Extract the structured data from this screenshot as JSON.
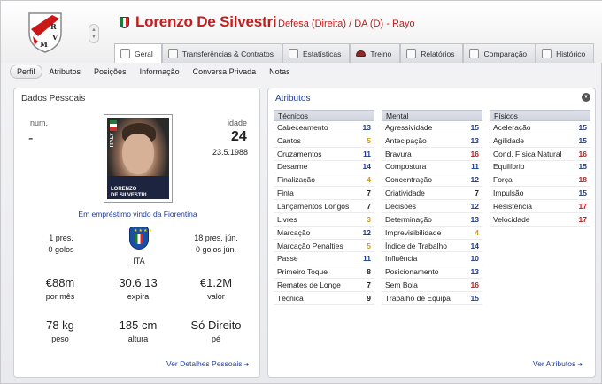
{
  "header": {
    "player_name": "Lorenzo De Silvestri",
    "role": "Defesa (Direita) / DA (D) - Rayo",
    "club_crest_letters": "RVM"
  },
  "tabs": [
    {
      "label": "Geral",
      "active": true,
      "icon": "profile-card-icon"
    },
    {
      "label": "Transferências & Contratos",
      "active": false,
      "icon": "document-icon"
    },
    {
      "label": "Estatísticas",
      "active": false,
      "icon": "stats-icon"
    },
    {
      "label": "Treino",
      "active": false,
      "icon": "cap-icon"
    },
    {
      "label": "Relatórios",
      "active": false,
      "icon": "report-icon"
    },
    {
      "label": "Comparação",
      "active": false,
      "icon": "compare-icon"
    },
    {
      "label": "Histórico",
      "active": false,
      "icon": "history-icon"
    }
  ],
  "subnav": [
    "Perfil",
    "Atributos",
    "Posições",
    "Informação",
    "Conversa Privada",
    "Notas"
  ],
  "personal": {
    "title": "Dados Pessoais",
    "num_label": "num.",
    "num_value": "-",
    "age_label": "idade",
    "age_value": "24",
    "dob": "23.5.1988",
    "photo_caption_1": "LORENZO",
    "photo_caption_2": "DE SILVESTRI",
    "photo_country": "ITALY",
    "loan_text": "Em empréstimo vindo da Fiorentina",
    "caps_left_1": "1 pres.",
    "caps_left_2": "0 golos",
    "nation": "ITA",
    "caps_right_1": "18 pres. jún.",
    "caps_right_2": "0 golos jún.",
    "wage_value": "€88m",
    "wage_label": "por mês",
    "expires_value": "30.6.13",
    "expires_label": "expira",
    "value_value": "€1.2M",
    "value_label": "valor",
    "weight_value": "78 kg",
    "weight_label": "peso",
    "height_value": "185 cm",
    "height_label": "altura",
    "foot_value": "Só Direito",
    "foot_label": "pé",
    "details_link": "Ver Detalhes Pessoais"
  },
  "attributes": {
    "title": "Atributos",
    "link": "Ver Atributos",
    "technical": {
      "title": "Técnicos",
      "rows": [
        {
          "name": "Cabeceamento",
          "value": "13",
          "color": "blue"
        },
        {
          "name": "Cantos",
          "value": "5",
          "color": "yellow"
        },
        {
          "name": "Cruzamentos",
          "value": "11",
          "color": "blue"
        },
        {
          "name": "Desarme",
          "value": "14",
          "color": "blue"
        },
        {
          "name": "Finalização",
          "value": "4",
          "color": "yellow"
        },
        {
          "name": "Finta",
          "value": "7",
          "color": "black"
        },
        {
          "name": "Lançamentos Longos",
          "value": "7",
          "color": "black"
        },
        {
          "name": "Livres",
          "value": "3",
          "color": "yellow"
        },
        {
          "name": "Marcação",
          "value": "12",
          "color": "blue"
        },
        {
          "name": "Marcação Penalties",
          "value": "5",
          "color": "yellow"
        },
        {
          "name": "Passe",
          "value": "11",
          "color": "blue"
        },
        {
          "name": "Primeiro Toque",
          "value": "8",
          "color": "black"
        },
        {
          "name": "Remates de Longe",
          "value": "7",
          "color": "black"
        },
        {
          "name": "Técnica",
          "value": "9",
          "color": "black"
        }
      ]
    },
    "mental": {
      "title": "Mental",
      "rows": [
        {
          "name": "Agressividade",
          "value": "15",
          "color": "blue"
        },
        {
          "name": "Antecipação",
          "value": "13",
          "color": "blue"
        },
        {
          "name": "Bravura",
          "value": "16",
          "color": "red"
        },
        {
          "name": "Compostura",
          "value": "11",
          "color": "blue"
        },
        {
          "name": "Concentração",
          "value": "12",
          "color": "blue"
        },
        {
          "name": "Criatividade",
          "value": "7",
          "color": "black"
        },
        {
          "name": "Decisões",
          "value": "12",
          "color": "blue"
        },
        {
          "name": "Determinação",
          "value": "13",
          "color": "blue"
        },
        {
          "name": "Imprevisibilidade",
          "value": "4",
          "color": "yellow"
        },
        {
          "name": "Índice de Trabalho",
          "value": "14",
          "color": "blue"
        },
        {
          "name": "Influência",
          "value": "10",
          "color": "blue"
        },
        {
          "name": "Posicionamento",
          "value": "13",
          "color": "blue"
        },
        {
          "name": "Sem Bola",
          "value": "16",
          "color": "red"
        },
        {
          "name": "Trabalho de Equipa",
          "value": "15",
          "color": "blue"
        }
      ]
    },
    "physical": {
      "title": "Físicos",
      "rows": [
        {
          "name": "Aceleração",
          "value": "15",
          "color": "blue"
        },
        {
          "name": "Agilidade",
          "value": "15",
          "color": "blue"
        },
        {
          "name": "Cond. Física Natural",
          "value": "16",
          "color": "red"
        },
        {
          "name": "Equilíbrio",
          "value": "15",
          "color": "blue"
        },
        {
          "name": "Força",
          "value": "18",
          "color": "red"
        },
        {
          "name": "Impulsão",
          "value": "15",
          "color": "blue"
        },
        {
          "name": "Resistência",
          "value": "17",
          "color": "red"
        },
        {
          "name": "Velocidade",
          "value": "17",
          "color": "red"
        }
      ]
    }
  }
}
